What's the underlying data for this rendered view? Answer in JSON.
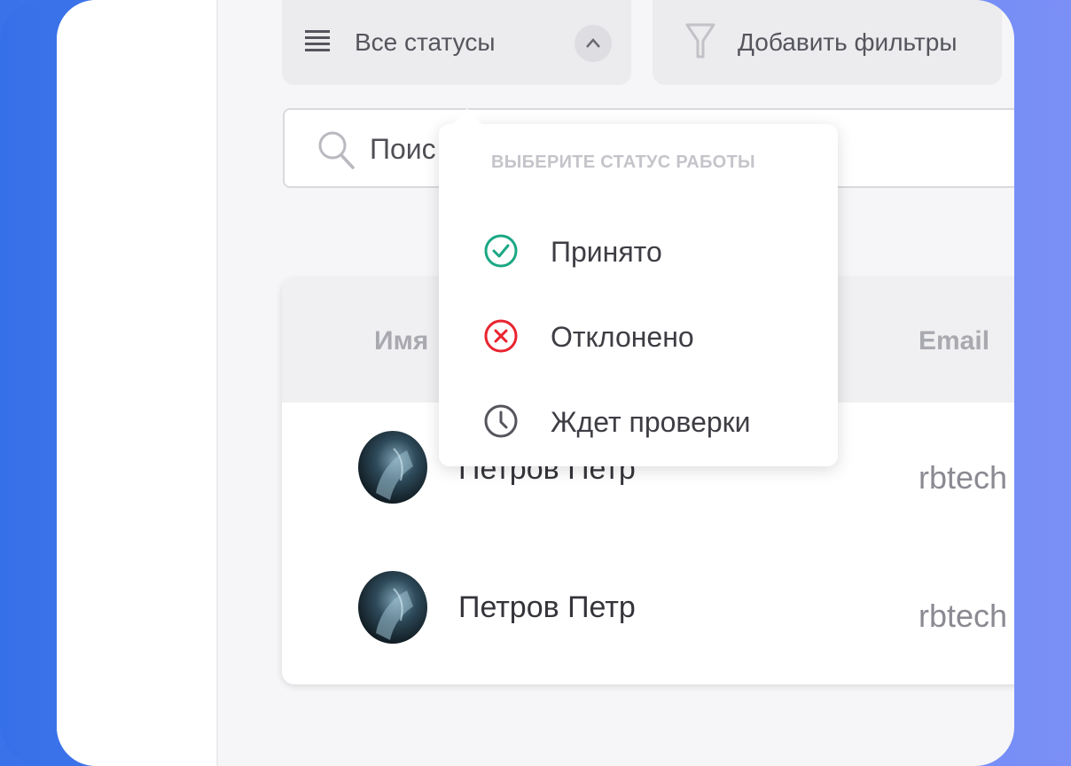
{
  "toolbar": {
    "status_filter_label": "Все статусы",
    "add_filters_label": "Добавить фильтры"
  },
  "search": {
    "placeholder": "Поис"
  },
  "table": {
    "headers": {
      "name": "Имя",
      "email": "Email"
    },
    "rows": [
      {
        "name": "Петров Петр",
        "email": "rbtech"
      },
      {
        "name": "Петров Петр",
        "email": "rbtech"
      }
    ]
  },
  "status_dropdown": {
    "title": "ВЫБЕРИТЕ СТАТУС РАБОТЫ",
    "options": [
      {
        "label": "Принято",
        "icon": "check-circle-icon",
        "color": "#1aa784"
      },
      {
        "label": "Отклонено",
        "icon": "x-circle-icon",
        "color": "#e8242f"
      },
      {
        "label": "Ждет проверки",
        "icon": "clock-icon",
        "color": "#55555d"
      }
    ]
  },
  "colors": {
    "frame_gradient_start": "#3670e8",
    "frame_gradient_end": "#7b90f7"
  }
}
